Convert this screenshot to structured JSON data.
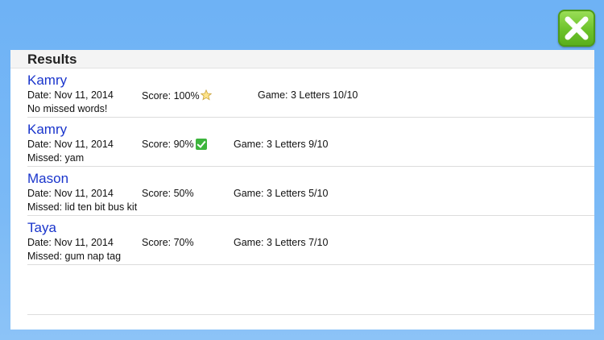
{
  "panel": {
    "title": "Results"
  },
  "results": [
    {
      "name": "Kamry",
      "date": "Date: Nov 11, 2014",
      "score": "Score: 100%",
      "score_icon": "star-icon",
      "game": "Game: 3 Letters 10/10",
      "missed": "No missed words!"
    },
    {
      "name": "Kamry",
      "date": "Date: Nov 11, 2014",
      "score": "Score: 90%",
      "score_icon": "check-icon",
      "game": "Game: 3 Letters 9/10",
      "missed": "Missed: yam"
    },
    {
      "name": "Mason",
      "date": "Date: Nov 11, 2014",
      "score": "Score: 50%",
      "score_icon": "",
      "game": "Game: 3 Letters 5/10",
      "missed": "Missed: lid ten bit bus kit"
    },
    {
      "name": "Taya",
      "date": "Date: Nov 11, 2014",
      "score": "Score: 70%",
      "score_icon": "",
      "game": "Game: 3 Letters 7/10",
      "missed": "Missed: gum nap tag"
    }
  ],
  "close_button": {
    "icon": "close-icon"
  },
  "colors": {
    "background": "#74b5f5",
    "name_link": "#1a35cc",
    "close_button": "#6cc22a"
  }
}
